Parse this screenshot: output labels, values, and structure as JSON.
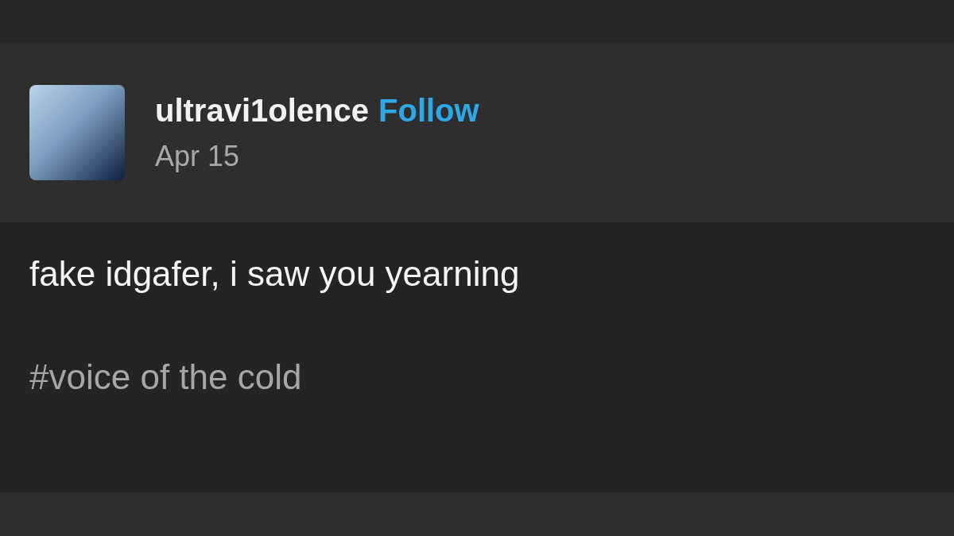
{
  "post": {
    "username": "ultravi1olence",
    "follow": "Follow",
    "date": "Apr 15",
    "text": "fake idgafer, i saw you yearning",
    "tags": [
      "#voice of the cold"
    ]
  }
}
